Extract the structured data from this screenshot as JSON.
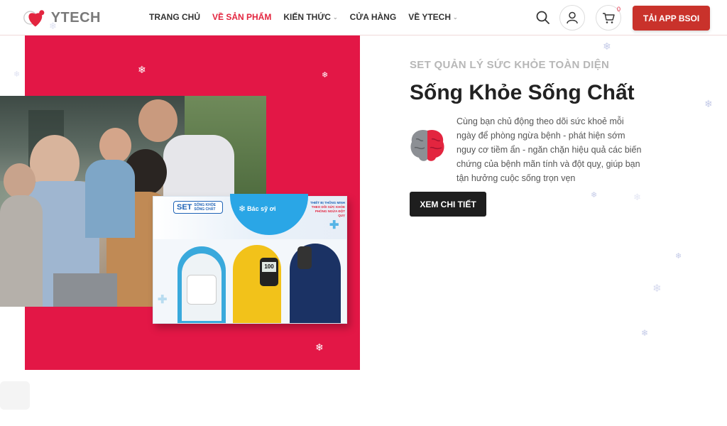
{
  "header": {
    "logo_text": "YTECH",
    "nav": [
      {
        "label": "TRANG CHỦ",
        "active": false,
        "has_dropdown": false
      },
      {
        "label": "VỀ SẢN PHẨM",
        "active": true,
        "has_dropdown": false
      },
      {
        "label": "KIẾN THỨC",
        "active": false,
        "has_dropdown": true
      },
      {
        "label": "CỬA HÀNG",
        "active": false,
        "has_dropdown": false
      },
      {
        "label": "VỀ YTECH",
        "active": false,
        "has_dropdown": true
      }
    ],
    "cart_count": "0",
    "app_button": "TẢI APP BSOI",
    "icons": {
      "search": "search-icon",
      "user": "user-icon",
      "cart": "cart-icon"
    }
  },
  "hero": {
    "subtitle": "SET QUẢN LÝ SỨC KHỎE TOÀN DIỆN",
    "title": "Sống Khỏe Sống Chất",
    "description": "Cùng bạn chủ động theo dõi sức khoẻ mỗi ngày để phòng ngừa bệnh - phát hiện sớm nguy cơ tiềm ẩn - ngăn chặn hiệu quả các biến chứng của bệnh mãn tính và đột quỵ, giúp bạn tận hưởng cuộc sống trọn vẹn",
    "cta": "XEM CHI TIẾT",
    "product_box": {
      "brand": "Bác sỹ ơi",
      "set_label": "SET",
      "set_text": "SỐNG KHỎE SỐNG CHẤT",
      "tagline": [
        "THIẾT BỊ THÔNG MINH",
        "THEO DÕI SỨC KHỎE",
        "PHÒNG NGỪA ĐỘT QUỴ"
      ],
      "meter_reading": "100"
    }
  },
  "colors": {
    "accent": "#e31746",
    "nav_active": "#e3253f",
    "app_button": "#c9322b",
    "cta": "#1e1e1e"
  }
}
